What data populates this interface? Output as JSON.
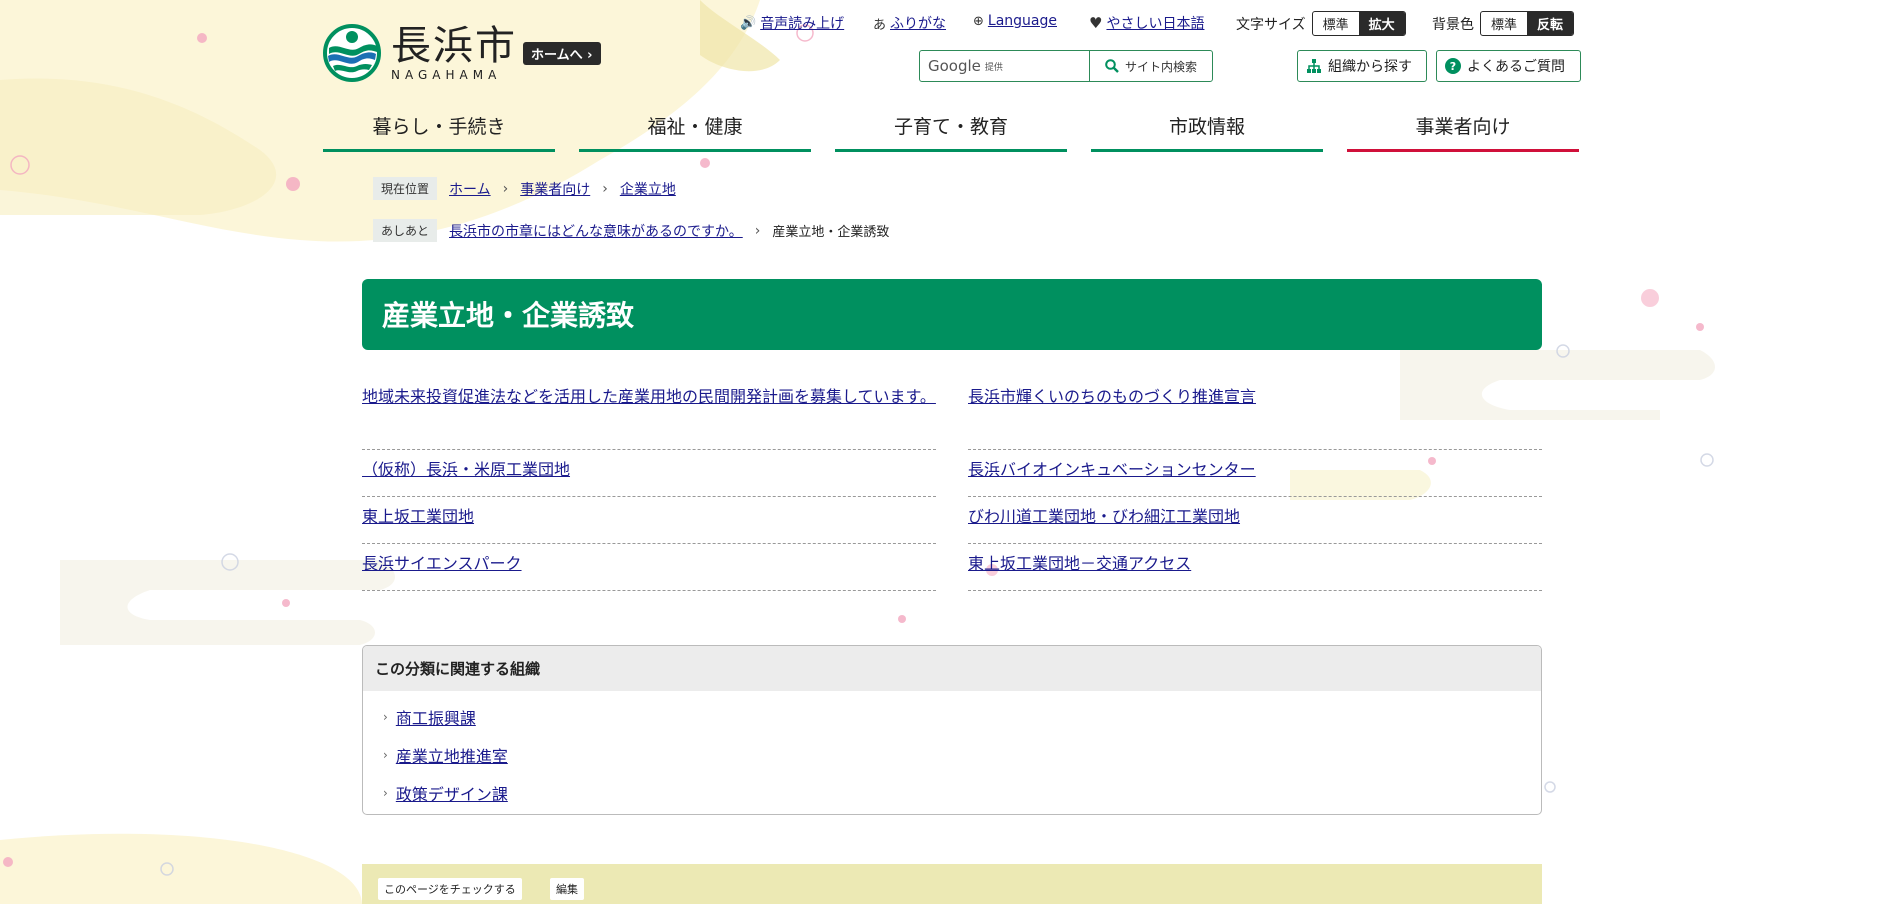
{
  "site": {
    "logo_jp": "長浜市",
    "logo_en": "NAGAHAMA",
    "home_button": "ホームへ"
  },
  "utility": {
    "read_aloud": "音声読み上げ",
    "furigana": "ふりがな",
    "language": "Language",
    "easy_japanese": "やさしい日本語",
    "font_size_label": "文字サイズ",
    "font_size_options": [
      "標準",
      "拡大"
    ],
    "bg_color_label": "背景色",
    "bg_color_options": [
      "標準",
      "反転"
    ]
  },
  "search": {
    "provider": "Google",
    "provider_note": "提供",
    "button_label": "サイト内検索"
  },
  "header_buttons": {
    "org_search": "組織から探す",
    "faq": "よくあるご質問"
  },
  "global_nav": [
    "暮らし・手続き",
    "福祉・健康",
    "子育て・教育",
    "市政情報",
    "事業者向け"
  ],
  "breadcrumb": {
    "label": "現在位置",
    "items": [
      "ホーム",
      "事業者向け",
      "企業立地"
    ]
  },
  "history": {
    "label": "あしあと",
    "prev": "長浜市の市章にはどんな意味があるのですか。",
    "current": "産業立地・企業誘致"
  },
  "page_title": "産業立地・企業誘致",
  "links": [
    "地域未来投資促進法などを活用した産業用地の民間開発計画を募集しています。",
    "長浜市輝くいのちのものづくり推進宣言",
    "（仮称）長浜・米原工業団地",
    "長浜バイオインキュベーションセンター",
    "東上坂工業団地",
    "びわ川道工業団地・びわ細江工業団地",
    "長浜サイエンスパーク",
    "東上坂工業団地－交通アクセス"
  ],
  "related_orgs": {
    "heading": "この分類に関連する組織",
    "items": [
      "商工振興課",
      "産業立地推進室",
      "政策デザイン課"
    ]
  },
  "footer_band": {
    "check_page": "このページをチェックする",
    "edit": "編集"
  },
  "colors": {
    "primary_green": "#00905f",
    "business_red": "#d0103a",
    "dark": "#2a2a2a"
  }
}
